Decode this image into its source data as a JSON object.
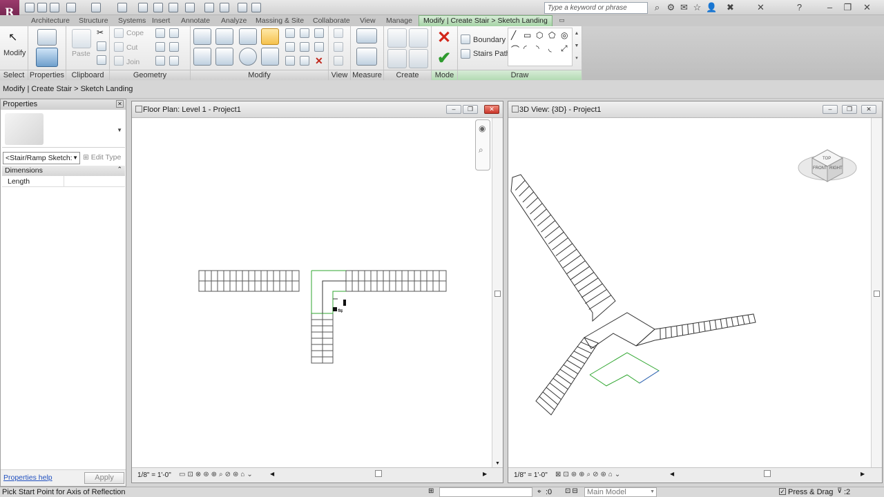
{
  "titlebar": {
    "search_placeholder": "Type a keyword or phrase"
  },
  "tabs": [
    "Architecture",
    "Structure",
    "Systems",
    "Insert",
    "Annotate",
    "Analyze",
    "Massing & Site",
    "Collaborate",
    "View",
    "Manage",
    "Modify | Create Stair > Sketch Landing"
  ],
  "ribbon": {
    "select": {
      "button": "Modify",
      "label": "Select"
    },
    "properties": {
      "label": "Properties"
    },
    "clipboard": {
      "paste": "Paste",
      "label": "Clipboard"
    },
    "geometry": {
      "cope": "Cope",
      "cut": "Cut",
      "join": "Join",
      "label": "Geometry"
    },
    "modify": {
      "label": "Modify"
    },
    "view": {
      "label": "View"
    },
    "measure": {
      "label": "Measure"
    },
    "create": {
      "label": "Create"
    },
    "mode": {
      "label": "Mode"
    },
    "draw": {
      "boundary": "Boundary",
      "stairs_path": "Stairs Path",
      "label": "Draw"
    }
  },
  "context_breadcrumb": "Modify | Create Stair > Sketch Landing",
  "properties_panel": {
    "title": "Properties",
    "type_selector": "<Stair/Ramp Sketch:",
    "edit_type": "Edit Type",
    "section": "Dimensions",
    "rows": [
      {
        "name": "Length",
        "value": ""
      }
    ],
    "help_link": "Properties help",
    "apply": "Apply"
  },
  "floor_plan": {
    "title": "Floor Plan: Level 1 - Project1",
    "scale": "1/8\" = 1'-0\""
  },
  "view_3d": {
    "title": "3D View: {3D} - Project1",
    "scale": "1/8\" = 1'-0\"",
    "viewcube": {
      "top": "TOP",
      "front": "FRONT",
      "right": "RIGHT"
    }
  },
  "status": {
    "message": "Pick Start Point for Axis of Reflection",
    "counter": ":0",
    "model": "Main Model",
    "press_drag": "Press & Drag",
    "filter": ":2"
  },
  "colors": {
    "sketch_green": "#2fa62f",
    "app_purple": "#7b2856"
  }
}
